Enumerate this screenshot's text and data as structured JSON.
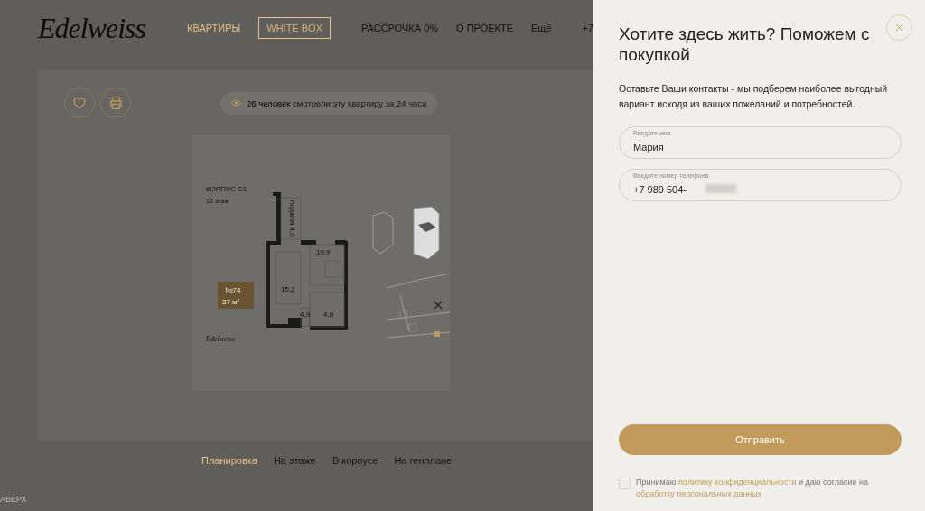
{
  "header": {
    "logo": "Edelweiss",
    "nav": [
      {
        "label": "КВАРТИРЫ",
        "selected": true,
        "boxed": false
      },
      {
        "label": "WHITE BOX",
        "selected": false,
        "boxed": true
      },
      {
        "label": "РАССРОЧКА 0%",
        "selected": false,
        "boxed": false
      },
      {
        "label": "О ПРОЕКТЕ",
        "selected": false,
        "boxed": false
      },
      {
        "label": "Ещё",
        "selected": false,
        "boxed": false
      }
    ],
    "phone": "+7"
  },
  "views": {
    "count": "26 человек",
    "text": "смотрели эту квартиру за 24 часа"
  },
  "plan": {
    "building": "КОРПУС С1",
    "floor": "12 этаж",
    "number": "№74",
    "area": "37 м²",
    "rooms": [
      "Лоджия 4,0",
      "10,9",
      "15,2",
      "4,9",
      "4,8"
    ],
    "brand": "Edelweiss"
  },
  "plan_tabs": [
    {
      "label": "Планировка",
      "selected": true
    },
    {
      "label": "На этаже",
      "selected": false
    },
    {
      "label": "В корпусе",
      "selected": false
    },
    {
      "label": "На генплане",
      "selected": false
    }
  ],
  "to_top": "АВЕРХ",
  "modal": {
    "title": "Хотите здесь жить? Поможем с покупкой",
    "text": "Оставьте Ваши контакты - мы подберем наиболее выгодный вариант исходя из ваших пожеланий и потребностей.",
    "fields": [
      {
        "label": "Введите имя",
        "value": "Мария",
        "blurred": false
      },
      {
        "label": "Введите номер телефона",
        "value": "+7 989 504-",
        "blurred": true
      }
    ],
    "submit": "Отправить",
    "consent": {
      "checked": false,
      "parts": [
        {
          "text": "Принимаю ",
          "link": false
        },
        {
          "text": "политику конфиденциальности",
          "link": true
        },
        {
          "text": " и даю согласие на ",
          "link": false
        },
        {
          "text": "обработку персональных данных",
          "link": true
        }
      ]
    }
  }
}
